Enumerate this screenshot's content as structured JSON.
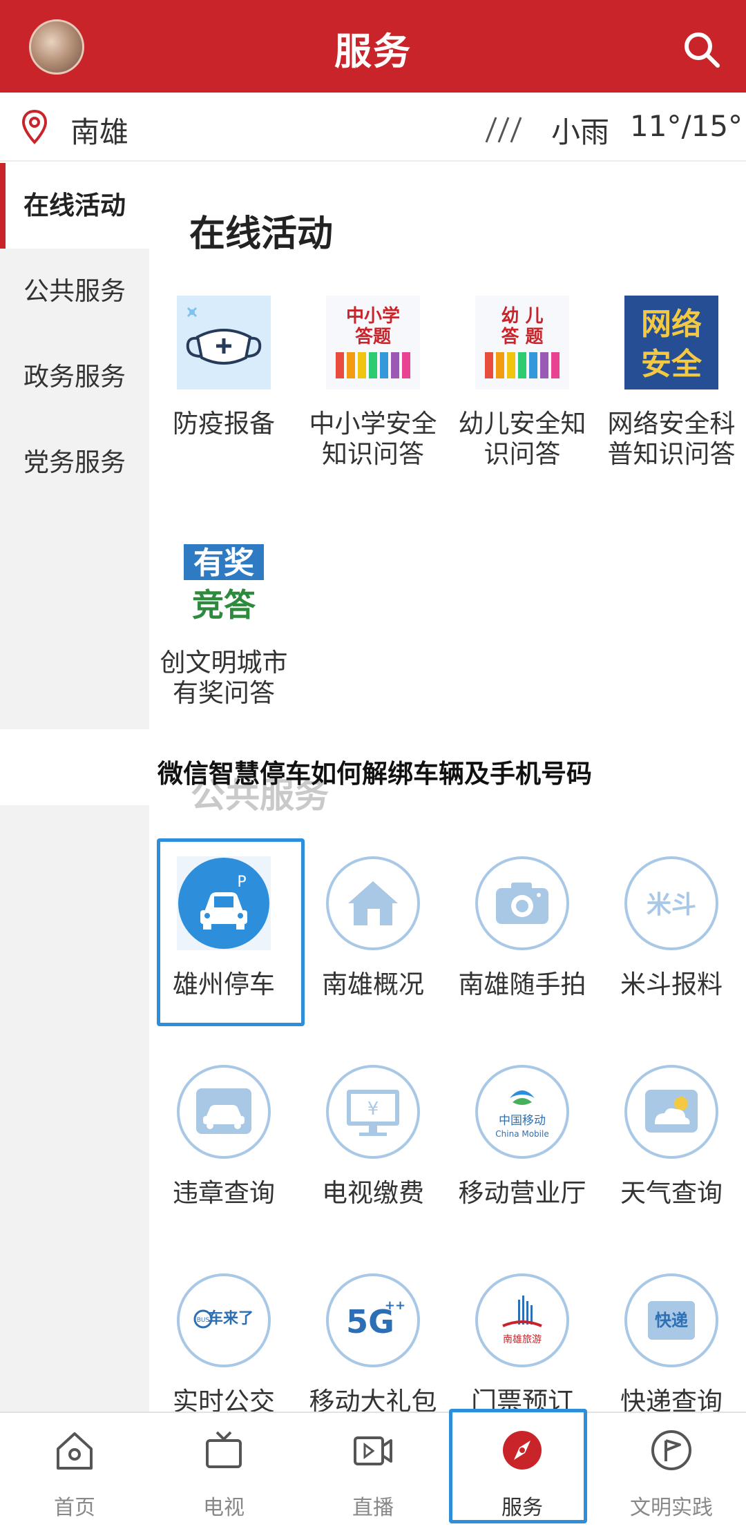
{
  "header": {
    "title": "服务"
  },
  "location": {
    "city": "南雄",
    "weather": "小雨",
    "temperature": "11°/15°"
  },
  "sidebar": {
    "items": [
      {
        "label": "在线活动"
      },
      {
        "label": "公共服务"
      },
      {
        "label": "政务服务"
      },
      {
        "label": "党务服务"
      }
    ]
  },
  "online": {
    "title": "在线活动",
    "items": [
      {
        "label": "防疫报备",
        "label2": ""
      },
      {
        "label": "中小学安全",
        "label2": "知识问答",
        "badge_line1": "中小学",
        "badge_line2": "答题"
      },
      {
        "label": "幼儿安全知",
        "label2": "识问答",
        "badge_line1": "幼 儿",
        "badge_line2": "答 题"
      },
      {
        "label": "网络安全科",
        "label2": "普知识问答",
        "badge_line1": "网络",
        "badge_line2": "安全"
      },
      {
        "label": "创文明城市",
        "label2": "有奖问答",
        "badge_line1": "有奖",
        "badge_line2": "竞答"
      }
    ]
  },
  "overlay_title": "微信智慧停车如何解绑车辆及手机号码",
  "public": {
    "title": "公共服务",
    "items": [
      {
        "label": "雄州停车",
        "icon": "parking-car-icon",
        "icon_text": "P"
      },
      {
        "label": "南雄概况",
        "icon": "house-icon"
      },
      {
        "label": "南雄随手拍",
        "icon": "camera-icon"
      },
      {
        "label": "米斗报料",
        "icon": "midou-icon",
        "icon_text": "米斗"
      },
      {
        "label": "违章查询",
        "icon": "car-icon"
      },
      {
        "label": "电视缴费",
        "icon": "tv-pay-icon",
        "icon_text": "¥"
      },
      {
        "label": "移动营业厅",
        "icon": "china-mobile-icon",
        "icon_text": "中国移动",
        "icon_text2": "China Mobile"
      },
      {
        "label": "天气查询",
        "icon": "weather-icon"
      },
      {
        "label": "实时公交",
        "icon": "bus-icon",
        "icon_text": "车来了",
        "icon_text2": "BUS"
      },
      {
        "label": "移动大礼包",
        "icon": "5g-icon",
        "icon_text": "5G"
      },
      {
        "label": "门票预订",
        "icon": "ticket-icon",
        "icon_text": "南雄旅游"
      },
      {
        "label": "快递查询",
        "icon": "express-icon",
        "icon_text": "快递"
      }
    ]
  },
  "bottomnav": {
    "items": [
      {
        "label": "首页"
      },
      {
        "label": "电视"
      },
      {
        "label": "直播"
      },
      {
        "label": "服务"
      },
      {
        "label": "文明实践"
      }
    ]
  },
  "colors": {
    "brand": "#c8242a",
    "highlight": "#2d8fdc",
    "icon_blue": "#2d8fdc"
  }
}
